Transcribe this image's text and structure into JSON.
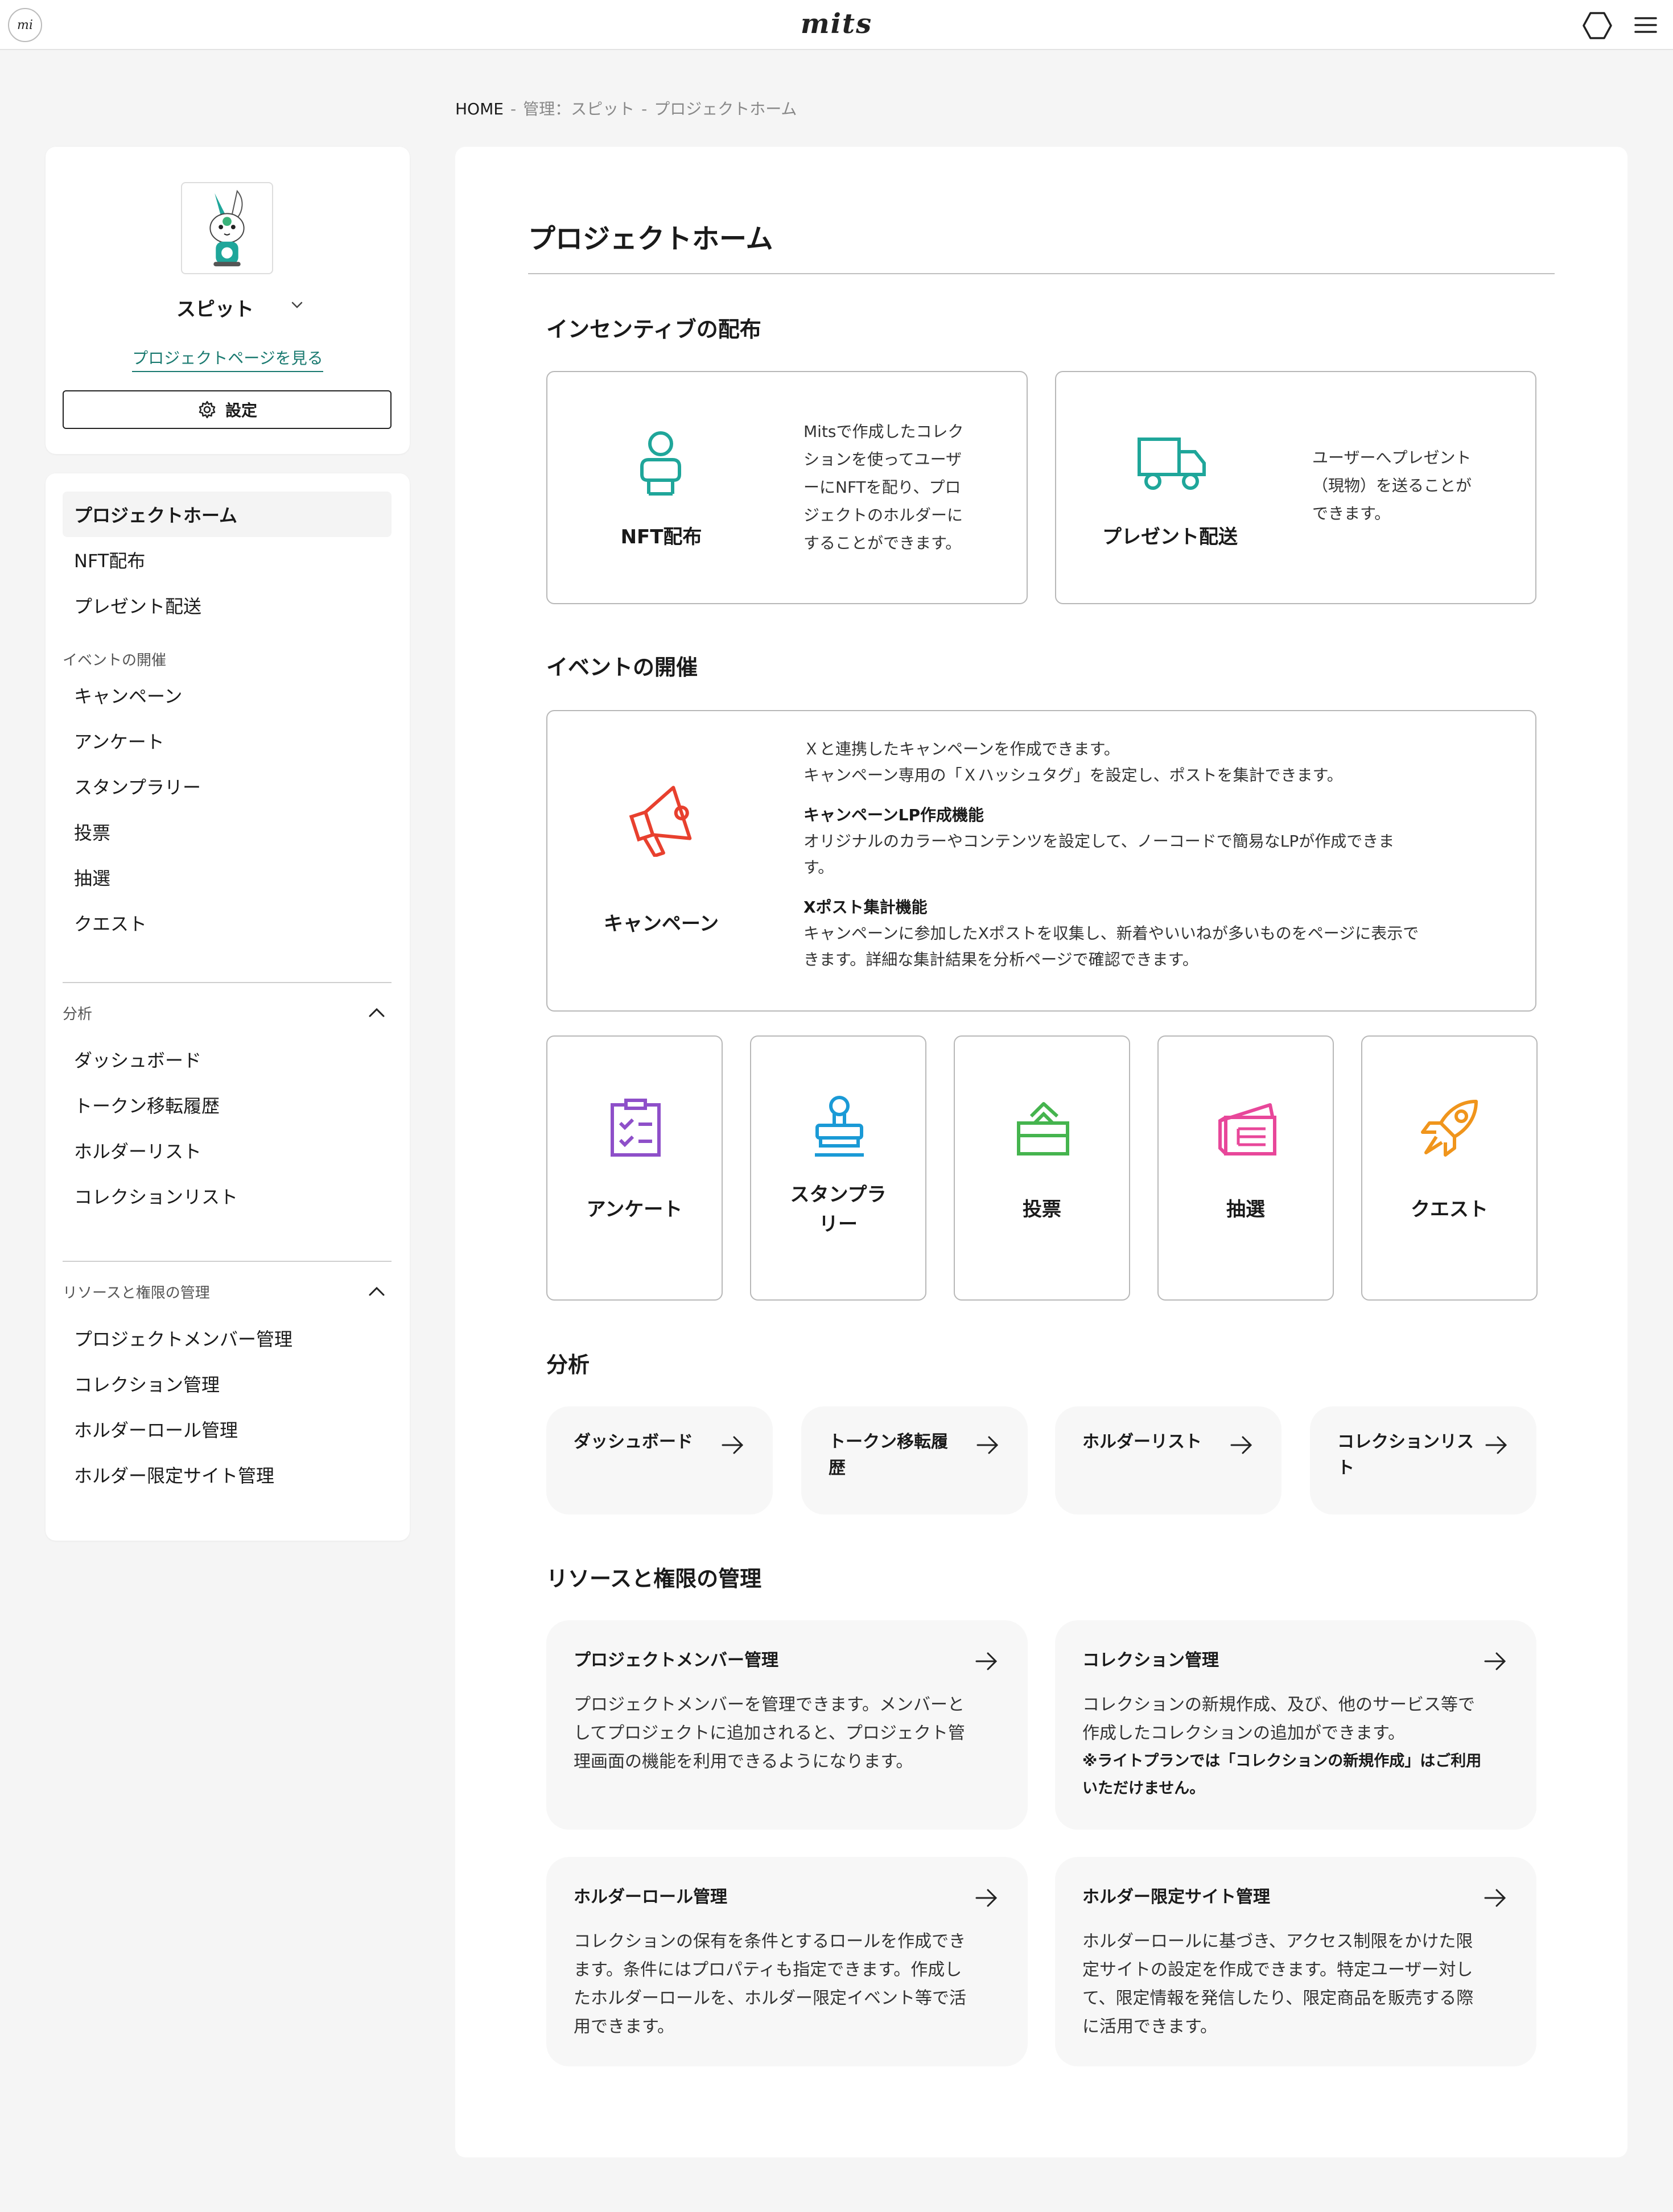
{
  "header": {
    "logo_mark": "mi",
    "brand": "mits",
    "icons": [
      "hexagon-icon",
      "hamburger-menu-icon"
    ]
  },
  "breadcrumb": {
    "home": "HOME",
    "sep1": "-",
    "level2": "管理：スピット",
    "sep2": "-",
    "level3": "プロジェクトホーム"
  },
  "project": {
    "name": "スピット",
    "view_link": "プロジェクトページを見る",
    "settings_label": "設定"
  },
  "sidebar": {
    "top_items": [
      {
        "label": "プロジェクトホーム",
        "active": true
      },
      {
        "label": "NFT配布"
      },
      {
        "label": "プレゼント配送"
      }
    ],
    "event_group": "イベントの開催",
    "event_items": [
      {
        "label": "キャンペーン"
      },
      {
        "label": "アンケート"
      },
      {
        "label": "スタンプラリー"
      },
      {
        "label": "投票"
      },
      {
        "label": "抽選"
      },
      {
        "label": "クエスト"
      }
    ],
    "analysis_group": "分析",
    "analysis_items": [
      {
        "label": "ダッシュボード"
      },
      {
        "label": "トークン移転履歴"
      },
      {
        "label": "ホルダーリスト"
      },
      {
        "label": "コレクションリスト"
      }
    ],
    "resource_group": "リソースと権限の管理",
    "resource_items": [
      {
        "label": "プロジェクトメンバー管理"
      },
      {
        "label": "コレクション管理"
      },
      {
        "label": "ホルダーロール管理"
      },
      {
        "label": "ホルダー限定サイト管理"
      }
    ]
  },
  "main": {
    "title": "プロジェクトホーム",
    "incentive": {
      "heading": "インセンティブの配布",
      "nft": {
        "title": "NFT配布",
        "desc": [
          "Mitsで作成したコレク",
          "ションを使ってユーザ",
          "ーにNFTを配り、プロ",
          "ジェクトのホルダーに",
          "することができます。"
        ]
      },
      "present": {
        "title": "プレゼント配送",
        "desc": [
          "ユーザーへプレゼント",
          "（現物）を送ることが",
          "できます。"
        ]
      }
    },
    "events": {
      "heading": "イベントの開催",
      "campaign": {
        "title": "キャンペーン",
        "intro": [
          "Ｘと連携したキャンペーンを作成できます。",
          "キャンペーン専用の「Ｘハッシュタグ」を設定し、ポストを集計できます。"
        ],
        "feature1_title": "キャンペーンLP作成機能",
        "feature1_desc": [
          "オリジナルのカラーやコンテンツを設定して、ノーコードで簡易なLPが作成できま",
          "す。"
        ],
        "feature2_title": "Xポスト集計機能",
        "feature2_desc": [
          "キャンペーンに参加したXポストを収集し、新着やいいねが多いものをページに表示で",
          "きます。詳細な集計結果を分析ページで確認できます。"
        ]
      },
      "small": [
        {
          "title_lines": [
            "アンケート"
          ],
          "icon": "survey-clipboard-icon",
          "color": "#8e4fc9"
        },
        {
          "title_lines": [
            "スタンプラ",
            "リー"
          ],
          "icon": "stamp-icon",
          "color": "#1a9ad6"
        },
        {
          "title_lines": [
            "投票"
          ],
          "icon": "ballot-box-icon",
          "color": "#45b44e"
        },
        {
          "title_lines": [
            "抽選"
          ],
          "icon": "lottery-ticket-icon",
          "color": "#e8479a"
        },
        {
          "title_lines": [
            "クエスト"
          ],
          "icon": "rocket-icon",
          "color": "#f0951c"
        }
      ]
    },
    "analysis": {
      "heading": "分析",
      "cards": [
        {
          "lines": [
            "ダッシュボード"
          ]
        },
        {
          "lines": [
            "トークン移転履",
            "歴"
          ]
        },
        {
          "lines": [
            "ホルダーリスト"
          ]
        },
        {
          "lines": [
            "コレクションリス",
            "ト"
          ]
        }
      ]
    },
    "resources": {
      "heading": "リソースと権限の管理",
      "members": {
        "title": "プロジェクトメンバー管理",
        "desc": [
          "プロジェクトメンバーを管理できます。メンバーと",
          "してプロジェクトに追加されると、プロジェクト管",
          "理画面の機能を利用できるようになります。"
        ]
      },
      "collection": {
        "title": "コレクション管理",
        "desc": [
          "コレクションの新規作成、及び、他のサービス等で",
          "作成したコレクションの追加ができます。"
        ],
        "note": [
          "※ライトプランでは「コレクションの新規作成」はご利用",
          "いただけません。"
        ]
      },
      "holder_role": {
        "title": "ホルダーロール管理",
        "desc": [
          "コレクションの保有を条件とするロールを作成でき",
          "ます。条件にはプロパティも指定できます。作成し",
          "たホルダーロールを、ホルダー限定イベント等で活",
          "用できます。"
        ]
      },
      "holder_site": {
        "title": "ホルダー限定サイト管理",
        "desc": [
          "ホルダーロールに基づき、アクセス制限をかけた限",
          "定サイトの設定を作成できます。特定ユーザー対し",
          "て、限定情報を発信したり、限定商品を販売する際",
          "に活用できます。"
        ]
      }
    }
  },
  "colors": {
    "accent_teal": "#1fa69a",
    "truck_teal": "#1fa69a",
    "campaign_red": "#e8402e",
    "link_teal": "#1a7a70"
  }
}
